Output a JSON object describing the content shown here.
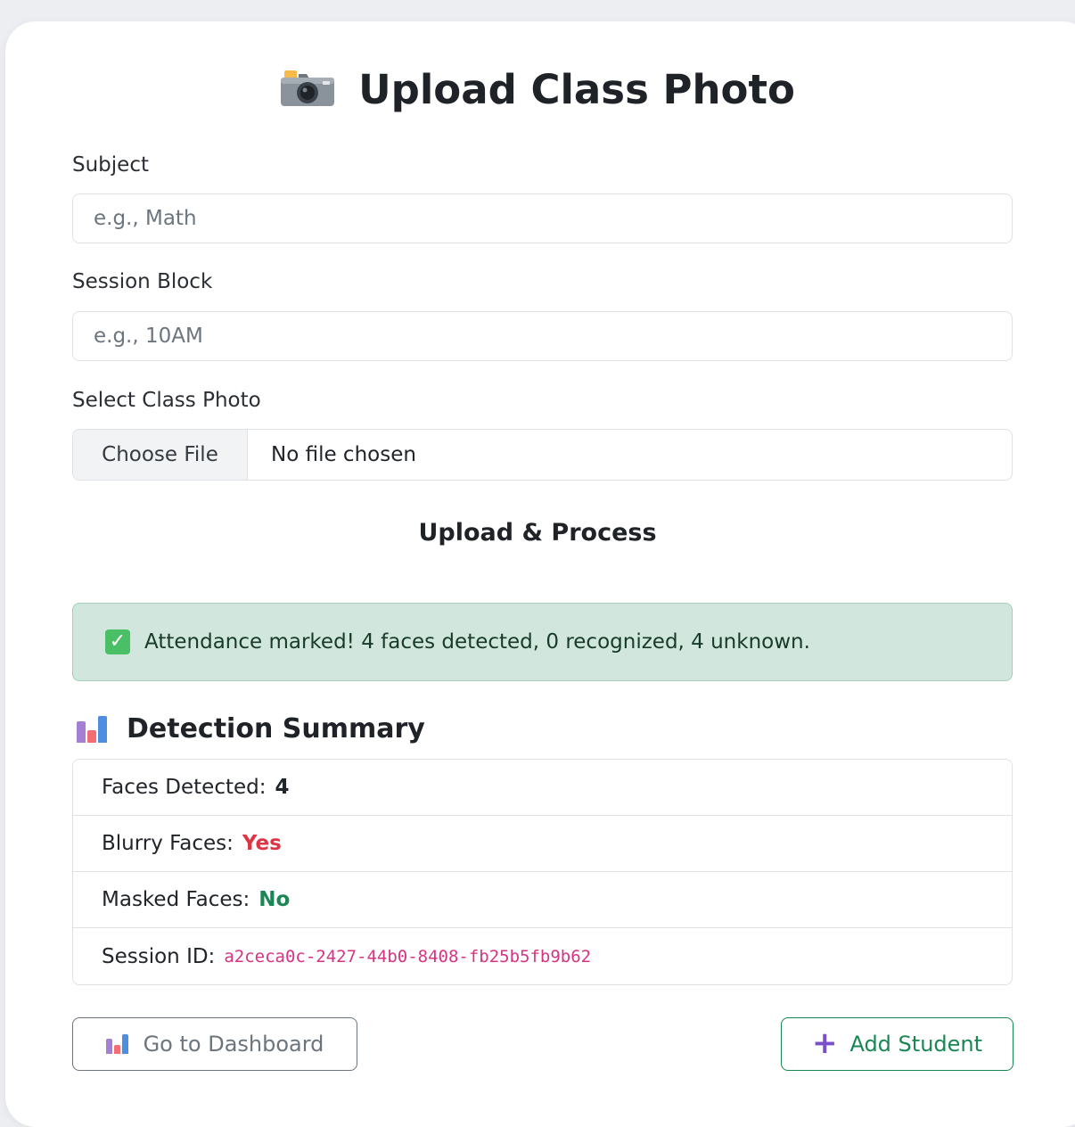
{
  "page": {
    "title": "Upload Class Photo",
    "title_icon": "camera-icon"
  },
  "form": {
    "subject": {
      "label": "Subject",
      "placeholder": "e.g., Math",
      "value": ""
    },
    "session": {
      "label": "Session Block",
      "placeholder": "e.g., 10AM",
      "value": ""
    },
    "photo": {
      "label": "Select Class Photo",
      "button": "Choose File",
      "status": "No file chosen"
    },
    "submit_label": "Upload & Process"
  },
  "alert": {
    "icon": "check-icon",
    "text": "Attendance marked! 4 faces detected, 0 recognized, 4 unknown."
  },
  "summary": {
    "title": "Detection Summary",
    "icon": "bar-chart-icon",
    "items": [
      {
        "label": "Faces Detected:",
        "value": "4"
      },
      {
        "label": "Blurry Faces:",
        "value": "Yes"
      },
      {
        "label": "Masked Faces:",
        "value": "No"
      },
      {
        "label": "Session ID:",
        "value": "a2ceca0c-2427-44b0-8408-fb25b5fb9b62"
      }
    ]
  },
  "actions": {
    "dashboard_label": "Go to Dashboard",
    "add_student_label": "Add Student"
  },
  "colors": {
    "alert_bg": "#d1e7dd",
    "yes_red": "#dc3545",
    "no_green": "#198754",
    "code_pink": "#d63384"
  }
}
